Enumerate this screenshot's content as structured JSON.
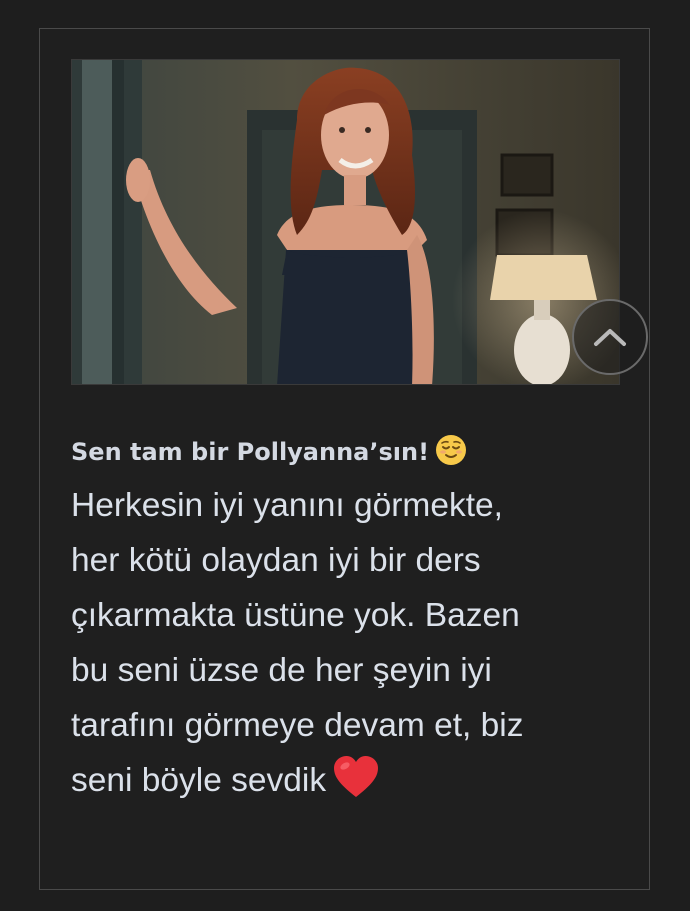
{
  "post": {
    "image_alt": "Woman with auburn hair in a dark dress smiling, leaning against a doorframe in a dim hallway",
    "heading": "Sen tam bir Pollyanna’sın!",
    "heading_emoji": "relieved-face-emoji",
    "body_line_1": "Herkesin iyi yanını görmekte,",
    "body_line_2": "her kötü olaydan iyi bir ders",
    "body_line_3": "çıkarmakta üstüne yok. Bazen",
    "body_line_4": "bu seni üzse de her şeyin iyi",
    "body_line_5": "tarafını görmeye devam et, biz",
    "body_line_6": "seni böyle sevdik",
    "body_emoji": "red-heart-emoji"
  },
  "controls": {
    "scroll_top_icon": "chevron-up-icon"
  },
  "colors": {
    "page_background": "#1e1e1e",
    "card_border": "#4a4a4a",
    "text": "#dbe1ea",
    "heart": "#e8313b",
    "emoji_face": "#f7c94a"
  }
}
